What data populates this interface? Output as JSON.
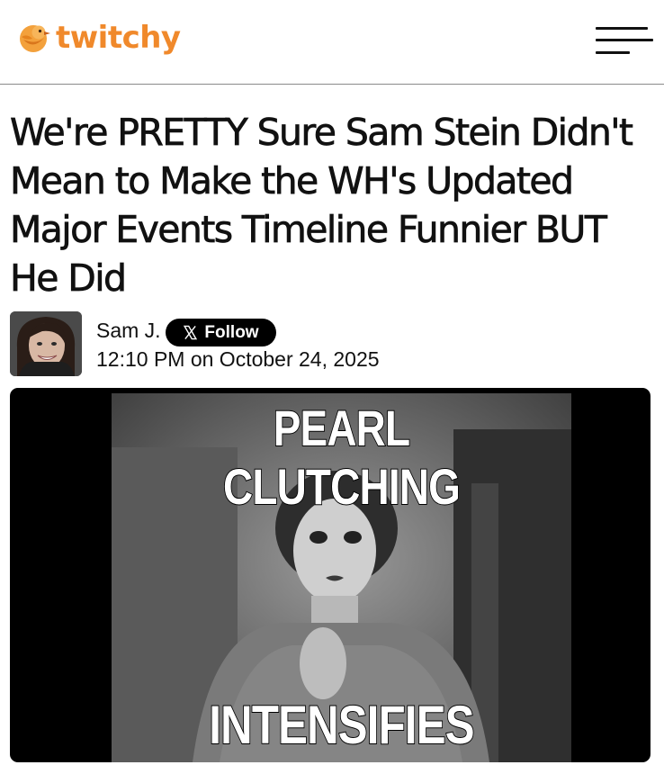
{
  "header": {
    "logo_text": "twitchy",
    "logo_icon": "bird-icon",
    "menu_icon": "hamburger-menu-icon",
    "brand_color": "#f0892b"
  },
  "article": {
    "headline": "We're PRETTY Sure Sam Stein Didn't Mean to Make the WH's Updated Major Events Timeline Funnier BUT He Did",
    "author": "Sam J.",
    "follow_label": "Follow",
    "follow_icon": "x-logo-icon",
    "published": "12:10 PM on October 24, 2025"
  },
  "hero_image": {
    "top_caption": "PEARL CLUTCHING",
    "bottom_caption": "INTENSIFIES"
  }
}
